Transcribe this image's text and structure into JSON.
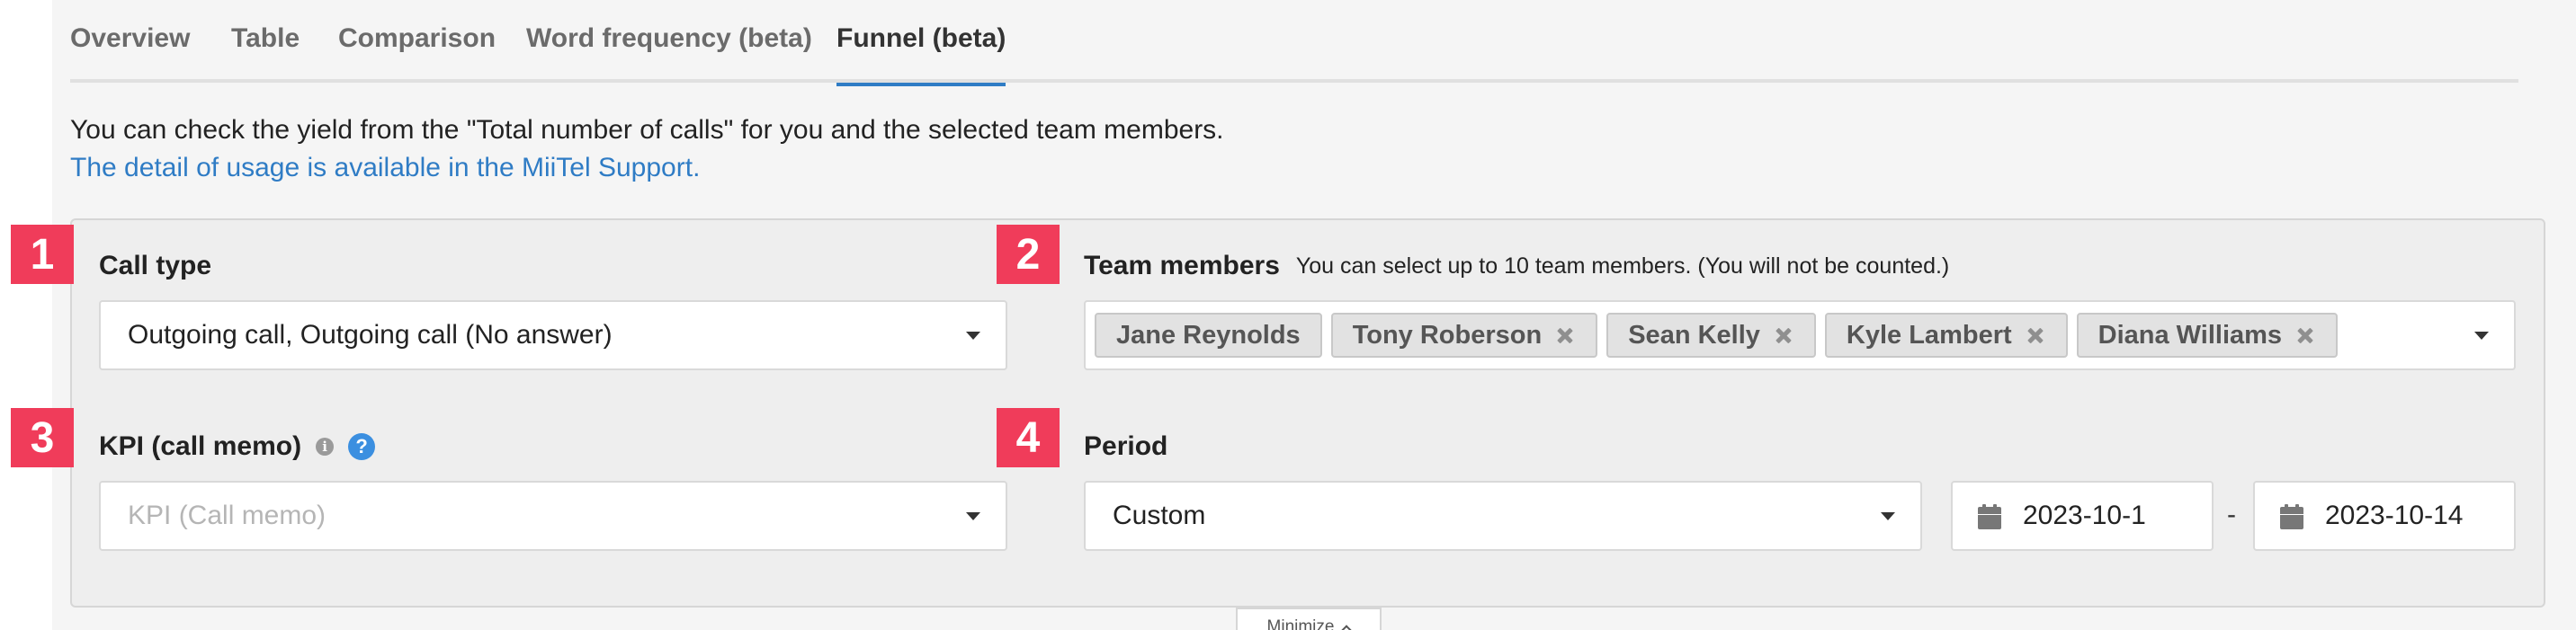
{
  "tabs": [
    {
      "label": "Overview",
      "active": false
    },
    {
      "label": "Table",
      "active": false
    },
    {
      "label": "Comparison",
      "active": false
    },
    {
      "label": "Word frequency (beta)",
      "active": false
    },
    {
      "label": "Funnel (beta)",
      "active": true
    }
  ],
  "intro": {
    "description": "You can check the yield from the \"Total number of calls\" for you and the selected team members.",
    "support_link": "The detail of usage is available in the MiiTel Support."
  },
  "badges": [
    "1",
    "2",
    "3",
    "4"
  ],
  "call_type": {
    "label": "Call type",
    "value": "Outgoing call, Outgoing call (No answer)"
  },
  "team_members": {
    "label": "Team members",
    "hint": "You can select up to 10 team members. (You will not be counted.)",
    "chips": [
      {
        "name": "Jane Reynolds",
        "removable": false
      },
      {
        "name": "Tony Roberson",
        "removable": true
      },
      {
        "name": "Sean Kelly",
        "removable": true
      },
      {
        "name": "Kyle Lambert",
        "removable": true
      },
      {
        "name": "Diana Williams",
        "removable": true
      }
    ]
  },
  "kpi": {
    "label": "KPI (call memo)",
    "info_glyph": "i",
    "help_glyph": "?",
    "placeholder": "KPI (Call memo)"
  },
  "period": {
    "label": "Period",
    "value": "Custom",
    "start_date": "2023-10-1",
    "separator": "-",
    "end_date": "2023-10-14"
  },
  "minimize_label": "Minimize",
  "colors": {
    "accent": "#2f7cc5",
    "badge": "#f03c5a",
    "help_icon": "#3b8fe0"
  },
  "icons": {
    "calendar": "calendar-icon",
    "remove": "remove-chip-icon",
    "dropdown": "chevron-down-icon",
    "info": "info-icon",
    "help": "help-icon"
  }
}
